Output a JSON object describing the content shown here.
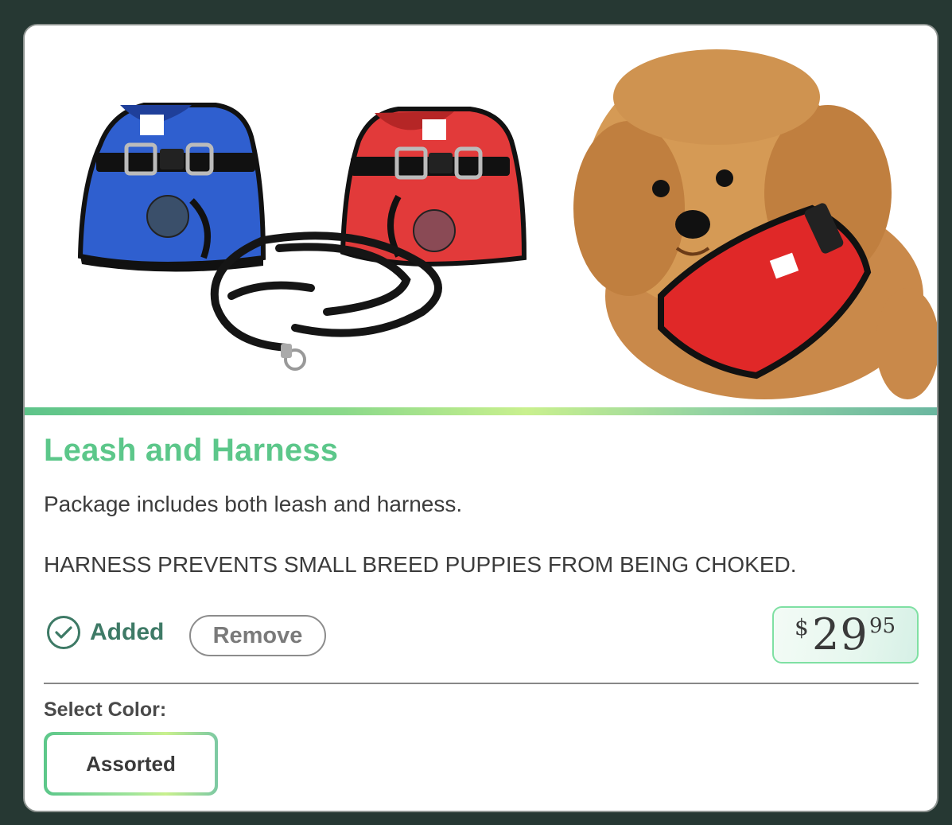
{
  "product": {
    "title": "Leash and Harness",
    "description_line1": "Package includes both leash and harness.",
    "description_line2": "HARNESS PREVENTS SMALL BREED PUPPIES FROM BEING CHOKED.",
    "image_alt": "Blue and red mesh dog harnesses with black leash, and a puppy wearing a red harness"
  },
  "cart": {
    "added_label": "Added",
    "added_icon": "check-circle-icon",
    "remove_label": "Remove"
  },
  "price": {
    "currency": "$",
    "dollars": "29",
    "cents": "95"
  },
  "options": {
    "color_label": "Select Color:",
    "selected_color": "Assorted"
  },
  "colors": {
    "title": "#5cc78a",
    "added": "#3e7a66",
    "background": "#263833"
  }
}
